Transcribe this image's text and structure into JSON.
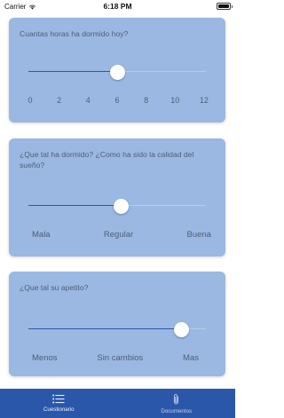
{
  "status": {
    "carrier": "Carrier",
    "time": "6:18 PM"
  },
  "questions": [
    {
      "text": "Cuantas horas ha dormido hoy?",
      "value_fraction": 0.5,
      "ticks": [
        "0",
        "2",
        "4",
        "6",
        "8",
        "10",
        "12"
      ]
    },
    {
      "text": "¿Que tal ha dormido? ¿Como ha sido la calidad del sueño?",
      "value_fraction": 0.52,
      "options": [
        "Mala",
        "Regular",
        "Buena"
      ]
    },
    {
      "text": "¿Que tal su apetito?",
      "value_fraction": 0.86,
      "options": [
        "Menos",
        "Sin cambios",
        "Mas"
      ]
    }
  ],
  "tabs": [
    {
      "label": "Cuestionario",
      "icon": "list-icon",
      "active": true
    },
    {
      "label": "Documentos",
      "icon": "paperclip-icon",
      "active": false
    }
  ],
  "colors": {
    "card": "#9ab8e2",
    "track_fill": "#2f55a8",
    "tabbar": "#2b57aa"
  }
}
